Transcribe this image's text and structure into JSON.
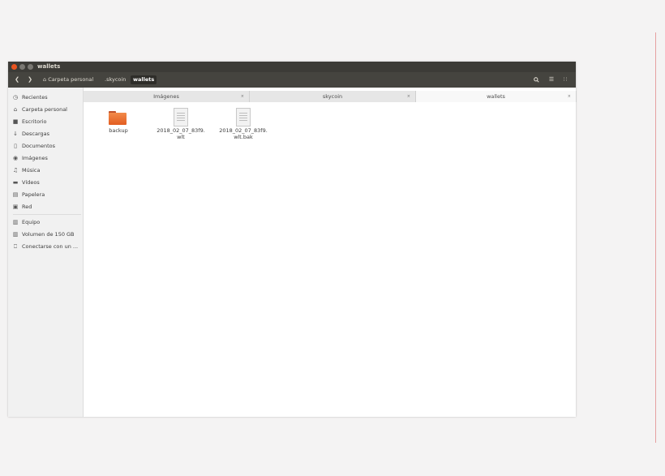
{
  "window": {
    "title": "wallets"
  },
  "toolbar": {
    "back_icon": "chevron-left-icon",
    "forward_icon": "chevron-right-icon",
    "breadcrumbs": [
      {
        "label": "Carpeta personal",
        "icon": "home-icon"
      },
      {
        "label": ".skycoin"
      },
      {
        "label": "wallets",
        "active": true
      }
    ],
    "search_icon": "search-icon",
    "list_view_icon": "list-view-icon",
    "grid_view_icon": "grid-view-icon"
  },
  "sidebar": {
    "items": [
      {
        "label": "Recientes",
        "icon": "clock-icon"
      },
      {
        "label": "Carpeta personal",
        "icon": "home-icon"
      },
      {
        "label": "Escritorio",
        "icon": "desktop-folder-icon"
      },
      {
        "label": "Descargas",
        "icon": "download-icon"
      },
      {
        "label": "Documentos",
        "icon": "document-icon"
      },
      {
        "label": "Imágenes",
        "icon": "camera-icon"
      },
      {
        "label": "Música",
        "icon": "music-icon"
      },
      {
        "label": "Vídeos",
        "icon": "video-icon"
      },
      {
        "label": "Papelera",
        "icon": "trash-icon"
      },
      {
        "label": "Red",
        "icon": "network-icon"
      }
    ],
    "devices": [
      {
        "label": "Equipo",
        "icon": "drive-icon"
      },
      {
        "label": "Volumen de 150 GB",
        "icon": "drive-icon"
      },
      {
        "label": "Conectarse con un ...",
        "icon": "server-icon"
      }
    ]
  },
  "tabs": [
    {
      "label": "Imágenes",
      "close": "×"
    },
    {
      "label": "skycoin",
      "close": "×"
    },
    {
      "label": "wallets",
      "close": "×",
      "active": true
    }
  ],
  "files": [
    {
      "name": "backup",
      "type": "folder"
    },
    {
      "name": "2018_02_07_83f9.\nwlt",
      "type": "document"
    },
    {
      "name": "2018_02_07_83f9.\nwlt.bak",
      "type": "document"
    }
  ],
  "colors": {
    "accent": "#e95420",
    "titlebar": "#3c3b37",
    "toolbar": "#45443f"
  }
}
